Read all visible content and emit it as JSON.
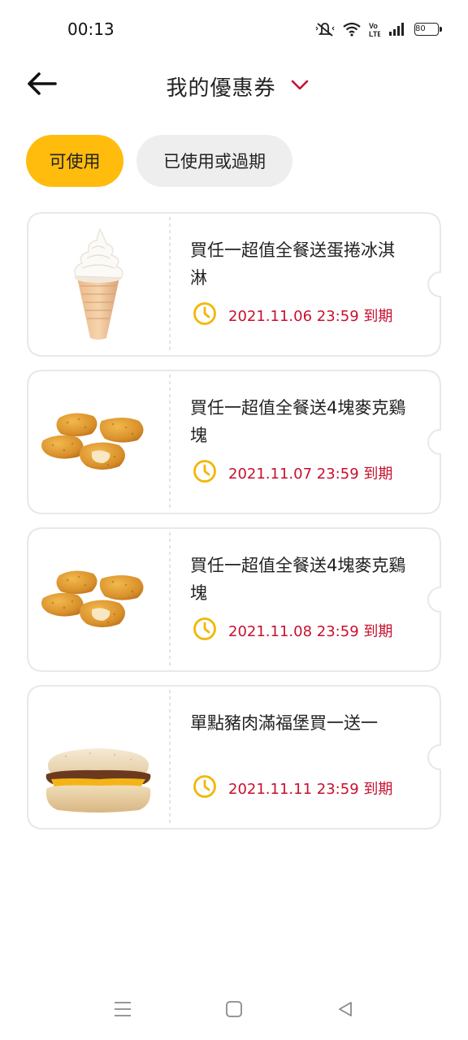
{
  "status_bar": {
    "time": "00:13",
    "battery": "80",
    "icons": [
      "mute-icon",
      "wifi-icon",
      "volte-icon",
      "signal-icon",
      "battery-icon"
    ]
  },
  "header": {
    "title": "我的優惠券",
    "back_icon": "back-arrow-icon",
    "dropdown_icon": "chevron-down-icon"
  },
  "tabs": [
    {
      "label": "可使用",
      "active": true
    },
    {
      "label": "已使用或過期",
      "active": false
    }
  ],
  "coupons": [
    {
      "title": "買任一超值全餐送蛋捲冰淇淋",
      "expiry": "2021.11.06 23:59 到期",
      "image": "ice-cream-cone"
    },
    {
      "title": "買任一超值全餐送4塊麥克鷄塊",
      "expiry": "2021.11.07 23:59 到期",
      "image": "chicken-nuggets"
    },
    {
      "title": "買任一超值全餐送4塊麥克鷄塊",
      "expiry": "2021.11.08 23:59 到期",
      "image": "chicken-nuggets"
    },
    {
      "title": "單點豬肉滿福堡買一送一",
      "expiry": "2021.11.11 23:59 到期",
      "image": "sausage-muffin"
    }
  ],
  "colors": {
    "accent_yellow": "#ffbc0d",
    "expiry_red": "#c8102e",
    "dropdown_red": "#c8102e",
    "clock_yellow": "#f2b705",
    "inactive_tab": "#eeeeee"
  },
  "nav_bar": {
    "icons": [
      "menu-icon",
      "home-icon",
      "back-icon"
    ]
  }
}
